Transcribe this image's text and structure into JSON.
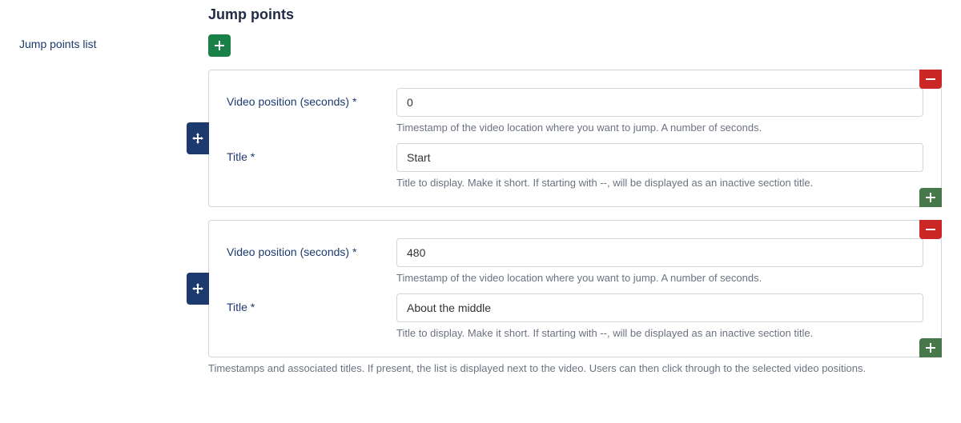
{
  "section_heading": "Jump points",
  "left_label": "Jump points list",
  "list_help": "Timestamps and associated titles. If present, the list is displayed next to the video. Users can then click through to the selected video positions.",
  "field_labels": {
    "position": "Video position (seconds) *",
    "title": "Title *"
  },
  "help": {
    "position": "Timestamp of the video location where you want to jump. A number of seconds.",
    "title": "Title to display. Make it short. If starting with --, will be displayed as an inactive section title."
  },
  "items": [
    {
      "position": "0",
      "title": "Start"
    },
    {
      "position": "480",
      "title": "About the middle"
    }
  ]
}
